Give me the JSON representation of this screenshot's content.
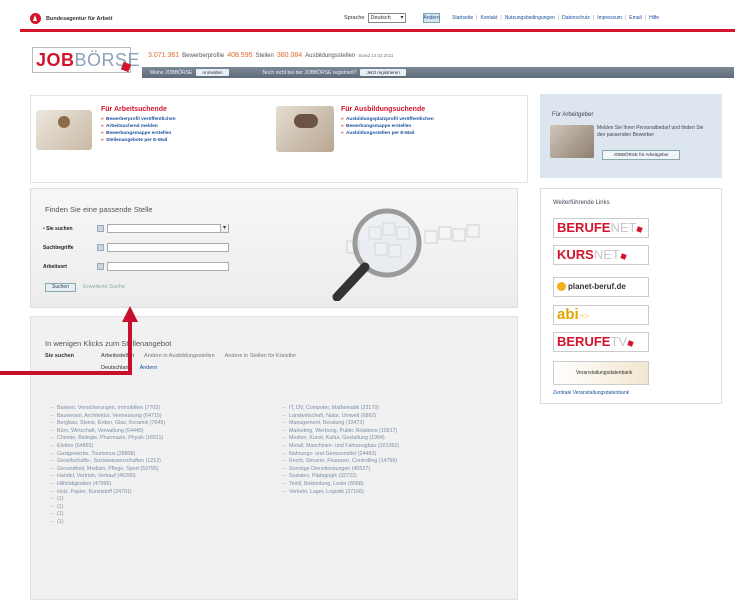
{
  "topbar": {
    "agency_name": "Bundesagentur für Arbeit",
    "language_label": "Sprache",
    "language_value": "Deutsch",
    "language_button": "Ändern",
    "links": [
      "Startseite",
      "Kontakt",
      "Nutzungsbedingungen",
      "Datenschutz",
      "Impressum",
      "Email",
      "Hilfe"
    ]
  },
  "header": {
    "logo_job": "JOB",
    "logo_boerse": "BÖRSE",
    "profiles_count": "3.071.361",
    "profiles_label": "Bewerberprofile",
    "jobs_count": "408.595",
    "jobs_label": "Stellen",
    "training_count": "380.084",
    "training_label": "Ausbildungsstellen",
    "stand": "Stand 14.02.2011",
    "nav_text1": "Meine JOBBÖRSE",
    "nav_btn1": "Anmelden",
    "nav_text2": "Noch nicht bei der JOBBÖRSE registriert?",
    "nav_btn2": "Jetzt registrieren"
  },
  "seekers": {
    "job_title": "Für Arbeitsuchende",
    "job_items": [
      "Bewerberprofil veröffentlichen",
      "Arbeitsuchend melden",
      "Bewerbungsmappe erstellen",
      "Stellenangebote per E-Mail"
    ],
    "train_title": "Für Ausbildungsuchende",
    "train_items": [
      "Ausbildungsplatzprofil veröffentlichen",
      "Bewerbungsmappe erstellen",
      "Ausbildungsstellen per E-Mail"
    ]
  },
  "search": {
    "title": "Finden Sie eine passende Stelle",
    "label_seek": "Sie suchen",
    "label_keyword": "Suchbegriffe",
    "label_place": "Arbeitsort",
    "button": "Suchen",
    "advanced": "Erweiterte Suche"
  },
  "lookup": {
    "title": "In wenigen Klicks zum Stellenangebot",
    "seek_label": "Sie suchen",
    "tabs": [
      "Arbeitsstellen",
      "Andere in Ausbildungsstellen",
      "Andere in Stellen für Künstler"
    ],
    "sub_active": "Deutschland",
    "sub_other": "Ändern",
    "col1": [
      "Banken, Versicherungen, Immobilien (7702)",
      "Bauwesen, Architektur, Vermessung (64715)",
      "Bergbau, Steine, Erden, Glas, Keramik (7645)",
      "Büro, Wirtschaft, Verwaltung (54445)",
      "Chemie, Biologie, Pharmazie, Physik (16511)",
      "Elektro (64865)",
      "Gastgewerbe, Tourismus (28808)",
      "Gesellschafts-, Sozialwissenschaften (1212)",
      "Gesundheit, Medizin, Pflege, Sport (53795)",
      "Handel, Vertrieb, Verkauf (46390)",
      "Hilfstätigkeiten (47996)",
      "Holz, Papier, Kunststoff (24791)",
      "(1)",
      "(1)",
      "(1)",
      "(1)"
    ],
    "col2": [
      "IT, DV, Computer, Mathematik (23179)",
      "Landwirtschaft, Natur, Umwelt (6862)",
      "Management, Beratung (10473)",
      "Marketing, Werbung, Public Relations (10917)",
      "Medien, Kunst, Kultur, Gestaltung (1994)",
      "Metall, Maschinen- und Fahrzeugbau (101362)",
      "Nahrungs- und Genussmittel (24483)",
      "Recht, Steuern, Finanzen, Controlling (14796)",
      "Sonstige Dienstleistungen (40527)",
      "Soziales, Pädagogik (32722)",
      "Textil, Bekleidung, Leder (6068)",
      "Verkehr, Lager, Logistik (37166)"
    ]
  },
  "employer": {
    "title": "Für Arbeitgeber",
    "text": "Melden Sie Ihren Personalbedarf und finden Sie den passenden Bewerber",
    "button": "JOBBÖRSE für Arbeitgeber"
  },
  "links": {
    "title": "Weiterführende Links",
    "berufenet_a": "BERUFE",
    "berufenet_b": "NET",
    "kursnet_a": "KURS",
    "kursnet_b": "NET",
    "planet": "planet-beruf.de",
    "abi_a": "abi",
    "abi_b": ">>",
    "berufetv_a": "BERUFE",
    "berufetv_b": "TV",
    "veranstaltung": "Veranstaltungsdatenbank",
    "zentral": "Zentrale Veranstaltungsdatenbank"
  },
  "colors": {
    "brand_red": "#d2152c",
    "link_blue": "#1a4f9c",
    "annotation_red": "#c8102e"
  }
}
